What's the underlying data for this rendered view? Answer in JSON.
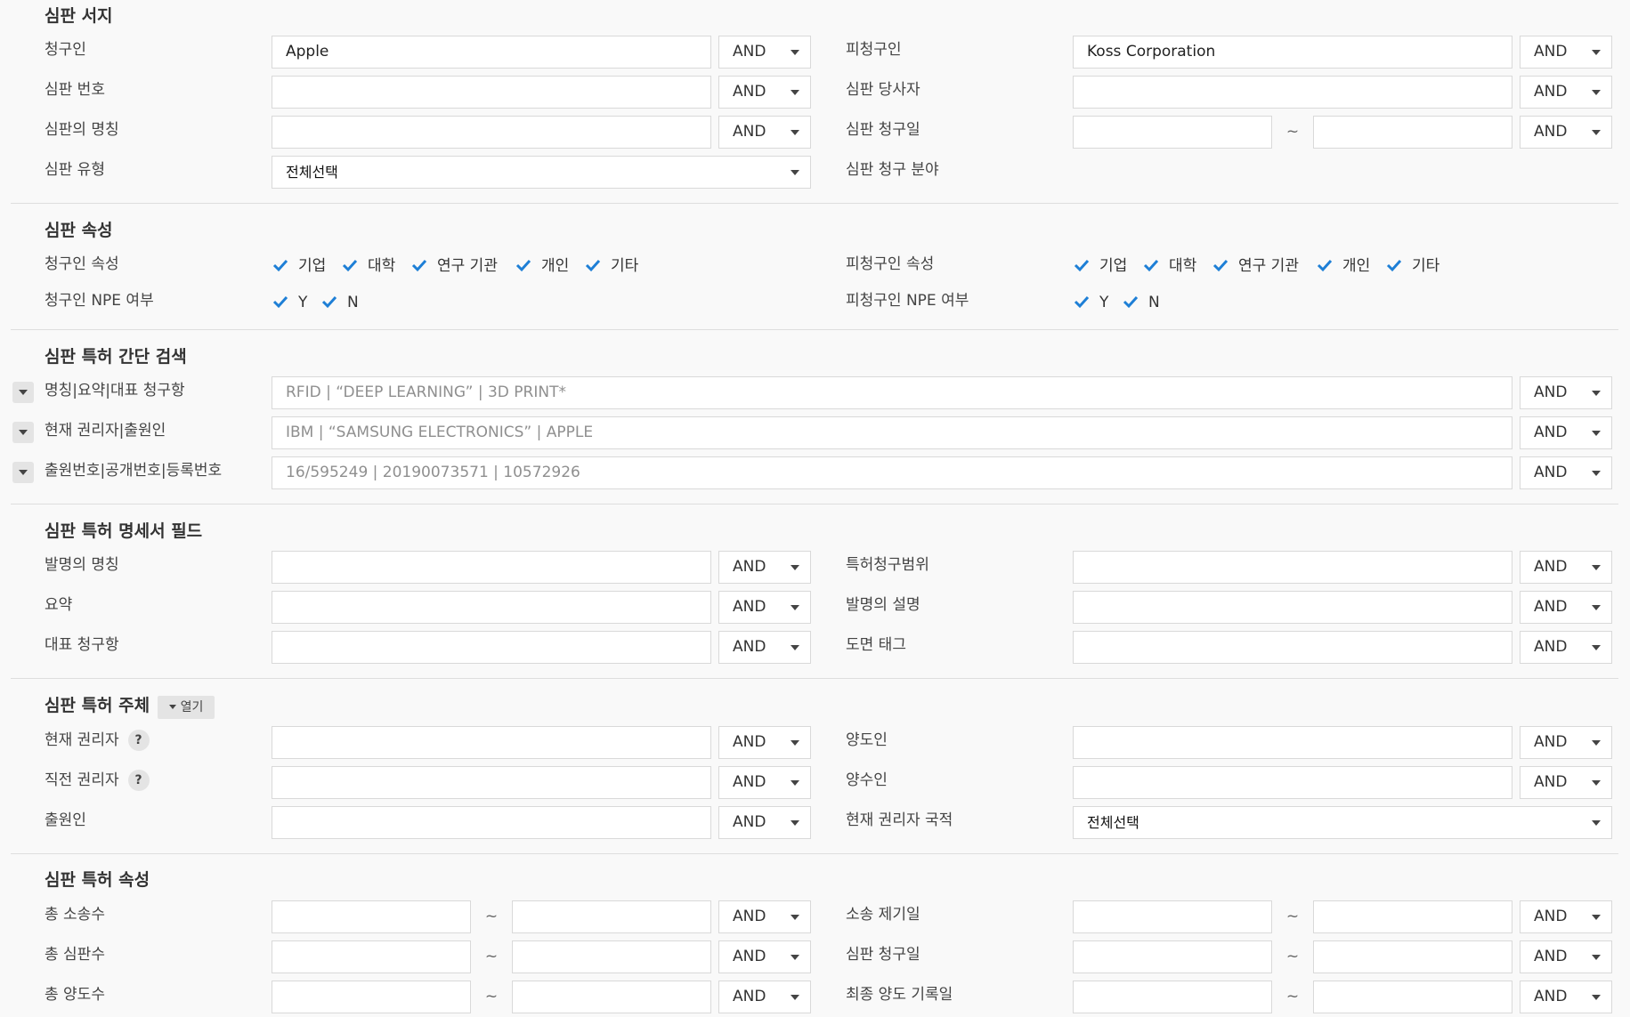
{
  "sections": {
    "trial_doc": "심판 서지",
    "trial_attr": "심판 속성",
    "quick_search": "심판 특허 간단 검색",
    "spec_fields": "심판 특허 명세서 필드",
    "subjects": "심판 특허 주체",
    "patent_attr": "심판 특허 속성"
  },
  "and_label": "AND",
  "tilde": "~",
  "trial_doc": {
    "claimant_label": "청구인",
    "claimant_value": "Apple",
    "respondent_label": "피청구인",
    "respondent_value": "Koss Corporation",
    "trial_no_label": "심판 번호",
    "party_label": "심판 당사자",
    "trial_name_label": "심판의 명칭",
    "request_date_label": "심판 청구일",
    "trial_type_label": "심판 유형",
    "trial_type_value": "전체선택",
    "field_label": "심판 청구 분야"
  },
  "trial_attr": {
    "claimant_attr_label": "청구인 속성",
    "respondent_attr_label": "피청구인 속성",
    "claimant_npe_label": "청구인 NPE 여부",
    "respondent_npe_label": "피청구인 NPE 여부",
    "attr_options": [
      "기업",
      "대학",
      "연구 기관",
      "개인",
      "기타"
    ],
    "npe_options": [
      "Y",
      "N"
    ]
  },
  "quick_search": {
    "row1_label": "명칭|요약|대표 청구항",
    "row1_placeholder": "RFID | “DEEP LEARNING” | 3D PRINT*",
    "row2_label": "현재 권리자|출원인",
    "row2_placeholder": "IBM | “SAMSUNG ELECTRONICS” | APPLE",
    "row3_label": "출원번호|공개번호|등록번호",
    "row3_placeholder": "16/595249 | 20190073571 | 10572926"
  },
  "spec_fields": {
    "invention_name": "발명의 명칭",
    "claims": "특허청구범위",
    "abstract": "요약",
    "description": "발명의 설명",
    "rep_claim": "대표 청구항",
    "drawing_tag": "도면 태그"
  },
  "subjects": {
    "open_button": "열기",
    "current_owner": "현재 권리자",
    "assignor": "양도인",
    "prev_owner": "직전 권리자",
    "assignee": "양수인",
    "applicant": "출원인",
    "owner_country": "현재 권리자 국적",
    "owner_country_value": "전체선택",
    "help_glyph": "?"
  },
  "patent_attr": {
    "total_lawsuits": "총 소송수",
    "lawsuit_date": "소송 제기일",
    "total_trials": "총 심판수",
    "trial_request_date": "심판 청구일",
    "total_transfers": "총 양도수",
    "last_transfer_date": "최종 양도 기록일"
  },
  "colors": {
    "checkbox": "#1e7fd6",
    "divider": "#dedede",
    "background": "#f9f9f9"
  }
}
